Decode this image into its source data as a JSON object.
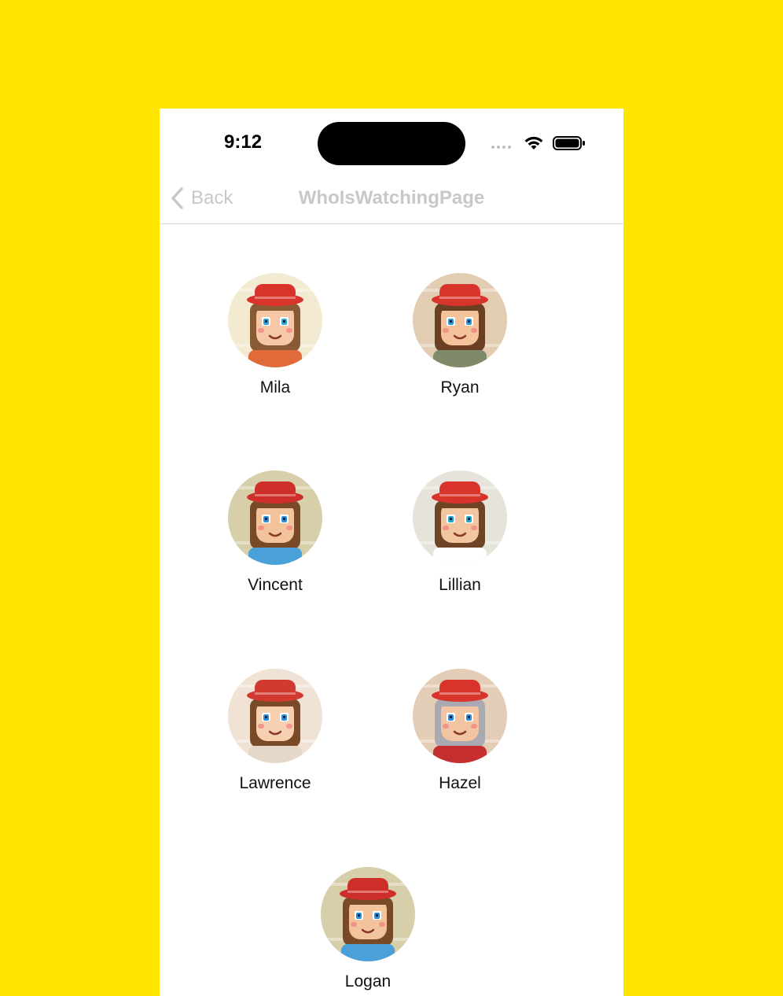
{
  "status_bar": {
    "time": "9:12"
  },
  "nav": {
    "back_label": "Back",
    "title": "WhoIsWatchingPage"
  },
  "profiles": [
    {
      "name": "Mila",
      "bg": "#f3ead2",
      "skin": "#f7c8a8",
      "hat": "#d9342b",
      "hair": "#8a5a34",
      "eyes": "#2aa7d6",
      "shirt": "#e06a3a"
    },
    {
      "name": "Ryan",
      "bg": "#e2cdb2",
      "skin": "#f4c39c",
      "hat": "#d9342b",
      "hair": "#6b3f22",
      "eyes": "#2a9bd6",
      "shirt": "#7f8a6b"
    },
    {
      "name": "Vincent",
      "bg": "#d7ceaa",
      "skin": "#f3c49b",
      "hat": "#cf2f2a",
      "hair": "#7a4a28",
      "eyes": "#2a8fd6",
      "shirt": "#4aa0d8"
    },
    {
      "name": "Lillian",
      "bg": "#e6e3da",
      "skin": "#f3c6a2",
      "hat": "#d9342b",
      "hair": "#6e4426",
      "eyes": "#21a7c9",
      "shirt": "#ffffff"
    },
    {
      "name": "Lawrence",
      "bg": "#f0e2d4",
      "skin": "#f6d0b0",
      "hat": "#d23a31",
      "hair": "#7a4a28",
      "eyes": "#2a8fd6",
      "shirt": "#e6d8c8"
    },
    {
      "name": "Hazel",
      "bg": "#e3cdb6",
      "skin": "#f2c4a2",
      "hat": "#d9342b",
      "hair": "#a9a9b2",
      "eyes": "#2a8fd6",
      "shirt": "#c62f2f"
    },
    {
      "name": "Logan",
      "bg": "#d7ceaa",
      "skin": "#f3c49b",
      "hat": "#cf2f2a",
      "hair": "#7a4a28",
      "eyes": "#2a8fd6",
      "shirt": "#4aa0d8"
    }
  ]
}
